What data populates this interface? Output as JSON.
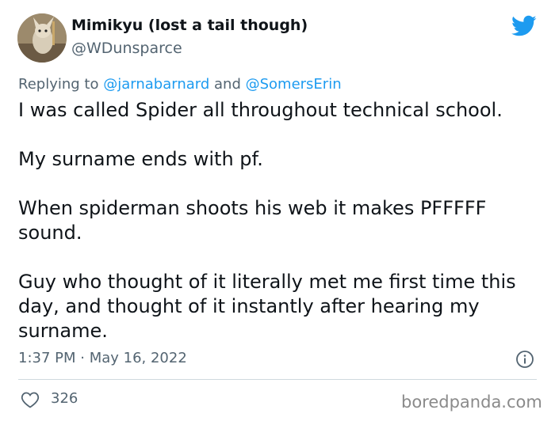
{
  "author": {
    "display_name": "Mimikyu (lost a tail though)",
    "handle": "@WDunsparce",
    "avatar": "avatar-photo"
  },
  "platform_icon": "twitter-bird-icon",
  "reply": {
    "prefix": "Replying to",
    "mention_1": "@jarnabarnard",
    "connector": "and",
    "mention_2": "@SomersErin"
  },
  "tweet": {
    "paragraphs": [
      "I was called Spider all throughout technical school.",
      "My surname ends with pf.",
      "When spiderman shoots his web it makes PFFFFF sound.",
      "Guy who thought of it literally met me first time this day, and thought of it instantly after hearing my surname."
    ]
  },
  "timestamp": "1:37 PM · May 16, 2022",
  "engagement": {
    "likes": "326"
  },
  "watermark": "boredpanda.com",
  "colors": {
    "text": "#0f1419",
    "secondary": "#536471",
    "accent": "#1d9bf0",
    "divider": "#cfd9de"
  }
}
